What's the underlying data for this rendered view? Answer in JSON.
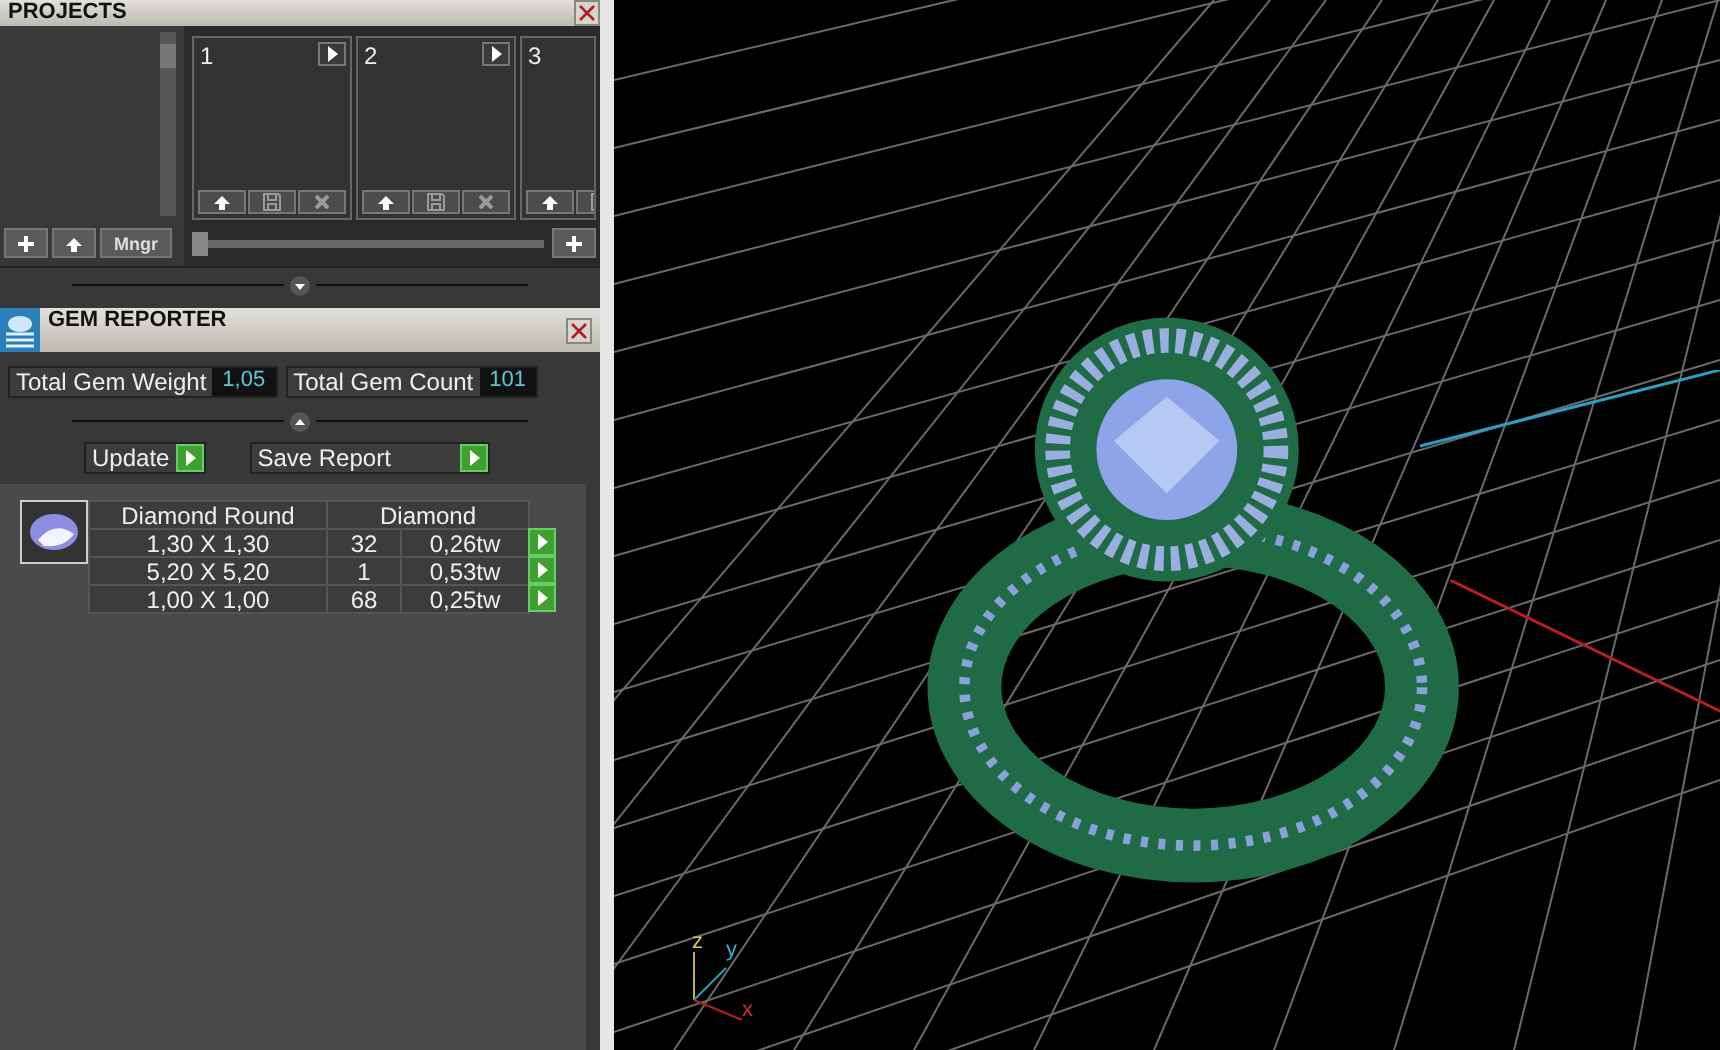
{
  "projects": {
    "title": "PROJECTS",
    "slots": [
      {
        "number": "1",
        "kind": "full"
      },
      {
        "number": "2",
        "kind": "full"
      },
      {
        "number": "3",
        "kind": "partial"
      }
    ],
    "buttons": [
      "Mngr"
    ],
    "slider": {
      "level": 0
    }
  },
  "gem_reporter": {
    "title": "GEM REPORTER",
    "totals": [
      {
        "label": "Total Gem Weight",
        "value": "1,05"
      },
      {
        "label": "Total Gem Count",
        "value": "101"
      }
    ],
    "actions": [
      "Update",
      "Save Report"
    ],
    "gem_list": {
      "shape": "Diamond Round",
      "material": "Diamond",
      "sizes": [
        {
          "size": "1,30 X 1,30",
          "count": "32",
          "weight": "0,26tw"
        },
        {
          "size": "5,20 X 5,20",
          "count": "1",
          "weight": "0,53tw"
        },
        {
          "size": "1,00 X 1,00",
          "count": "68",
          "weight": "0,25tw"
        }
      ]
    }
  },
  "viewport": {
    "axes": [
      "z",
      "y",
      "x"
    ]
  }
}
